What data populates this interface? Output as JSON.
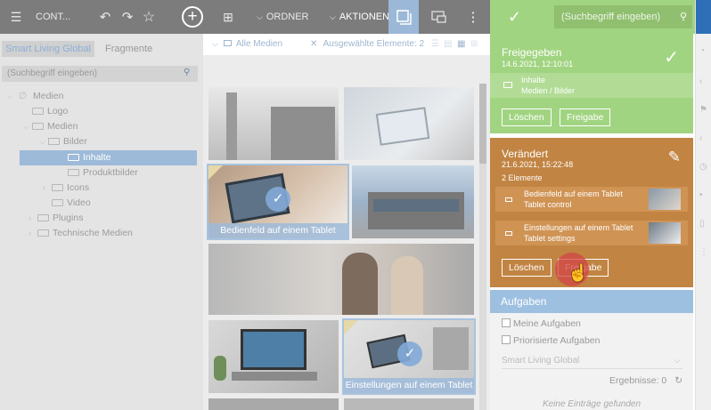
{
  "topbar": {
    "title": "CONT...",
    "undo_icon": "↶",
    "redo_icon": "↷",
    "star_icon": "☆",
    "plus_icon": "+",
    "grid_icon": "⊞",
    "ordner": "ORDNER",
    "aktionen": "AKTIONEN",
    "more_icon": "⋮"
  },
  "left": {
    "tabs": [
      "Smart Living Global",
      "Fragmente"
    ],
    "search_placeholder": "(Suchbegriff eingeben)",
    "tree": [
      {
        "label": "Medien"
      },
      {
        "label": "Logo"
      },
      {
        "label": "Medien"
      },
      {
        "label": "Bilder"
      },
      {
        "label": "Inhalte"
      },
      {
        "label": "Produktbilder"
      },
      {
        "label": "Icons"
      },
      {
        "label": "Video"
      },
      {
        "label": "Plugins"
      },
      {
        "label": "Technische Medien"
      }
    ]
  },
  "media": {
    "filter": "Alle Medien",
    "selected": "Ausgewählte Elemente: 2",
    "captions": {
      "bedienfeld": "Bedienfeld auf einem Tablet",
      "einstellungen": "Einstellungen auf einem Tablet"
    }
  },
  "right": {
    "search_placeholder": "(Suchbegriff eingeben)",
    "freigegeben": {
      "title": "Freigegeben",
      "date": "14.6.2021, 12:10:01",
      "row_line1": "Inhalte",
      "row_line2": "Medien / Bilder",
      "btn_delete": "Löschen",
      "btn_release": "Freigabe"
    },
    "veraendert": {
      "title": "Verändert",
      "date": "21.6.2021, 15:22:48",
      "count": "2 Elemente",
      "items": [
        {
          "line1": "Bedienfeld auf einem Tablet",
          "line2": "Tablet control"
        },
        {
          "line1": "Einstellungen auf einem Tablet",
          "line2": "Tablet settings"
        }
      ],
      "btn_delete": "Löschen",
      "btn_release": "Freigabe"
    },
    "aufgaben": {
      "title": "Aufgaben",
      "my_tasks": "Meine Aufgaben",
      "prio_tasks": "Priorisierte Aufgaben",
      "select_value": "Smart Living Global",
      "results": "Ergebnisse: 0",
      "empty": "Keine Einträge gefunden"
    }
  }
}
